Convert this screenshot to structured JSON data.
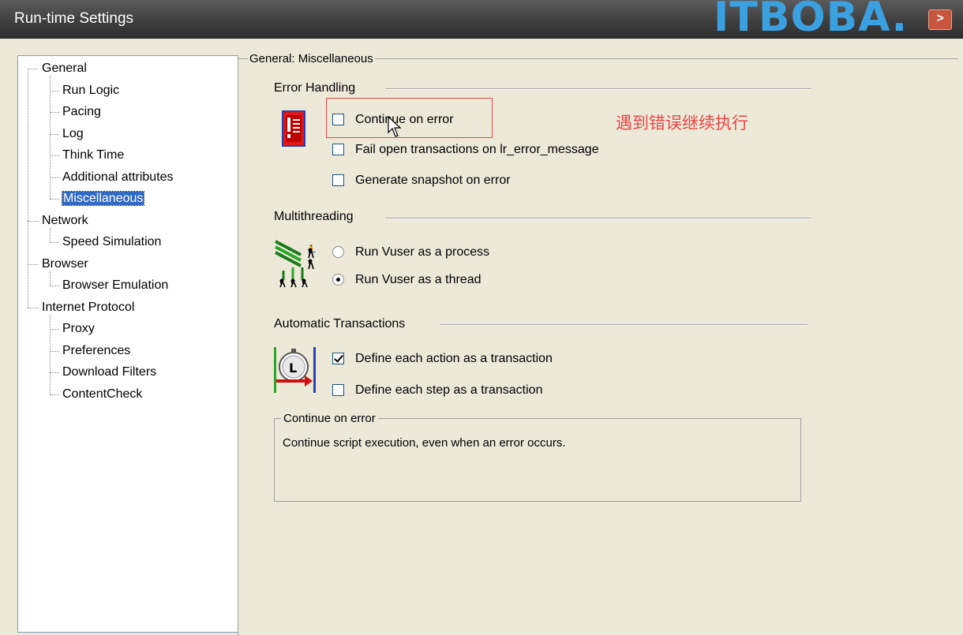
{
  "window": {
    "title": "Run-time Settings",
    "watermark": "ITBOBA.",
    "close_glyph": ">"
  },
  "tree": {
    "items": [
      {
        "label": "General",
        "level": 0
      },
      {
        "label": "Run Logic",
        "level": 1
      },
      {
        "label": "Pacing",
        "level": 1
      },
      {
        "label": "Log",
        "level": 1
      },
      {
        "label": "Think Time",
        "level": 1
      },
      {
        "label": "Additional attributes",
        "level": 1
      },
      {
        "label": "Miscellaneous",
        "level": 1,
        "selected": true
      },
      {
        "label": "Network",
        "level": 0
      },
      {
        "label": "Speed Simulation",
        "level": 1
      },
      {
        "label": "Browser",
        "level": 0
      },
      {
        "label": "Browser Emulation",
        "level": 1
      },
      {
        "label": "Internet Protocol",
        "level": 0
      },
      {
        "label": "Proxy",
        "level": 1
      },
      {
        "label": "Preferences",
        "level": 1
      },
      {
        "label": "Download Filters",
        "level": 1
      },
      {
        "label": "ContentCheck",
        "level": 1
      }
    ]
  },
  "main": {
    "group_title": "General: Miscellaneous",
    "error_handling": {
      "title": "Error Handling",
      "continue_on_error": {
        "label": "Continue on error",
        "checked": false
      },
      "fail_open_transactions": {
        "label": "Fail open transactions on lr_error_message",
        "checked": false
      },
      "generate_snapshot": {
        "label": "Generate snapshot on error",
        "checked": false
      }
    },
    "multithreading": {
      "title": "Multithreading",
      "run_as_process": {
        "label": "Run Vuser as a process",
        "selected": false
      },
      "run_as_thread": {
        "label": "Run Vuser as a thread",
        "selected": true
      }
    },
    "automatic_transactions": {
      "title": "Automatic Transactions",
      "define_action": {
        "label": "Define each action as a transaction",
        "checked": true
      },
      "define_step": {
        "label": "Define each step as a transaction",
        "checked": false
      }
    },
    "description": {
      "title": "Continue on error",
      "text": "Continue script execution, even when an error occurs."
    }
  },
  "annotation": {
    "text": "遇到错误继续执行",
    "color": "#e8484a"
  }
}
